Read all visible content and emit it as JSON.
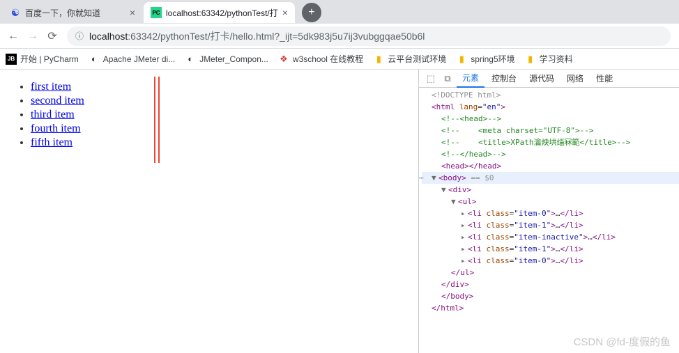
{
  "tabs": [
    {
      "title": "百度一下，你就知道",
      "favicon": "🐾",
      "active": false
    },
    {
      "title": "localhost:63342/pythonTest/打",
      "favicon": "PC",
      "active": true
    }
  ],
  "newtab": "+",
  "nav": {
    "back": "←",
    "fwd": "→",
    "reload": "⟳",
    "lock": "ⓘ"
  },
  "url": {
    "host": "localhost",
    "path": ":63342/pythonTest/打卡/hello.html?_ijt=5dk983j5u7ij3vubggqae50b6l"
  },
  "bookmarks": [
    {
      "icon": "JB",
      "label": "开始 | PyCharm",
      "type": "jb"
    },
    {
      "icon": "◐",
      "label": "Apache JMeter di...",
      "type": "apache"
    },
    {
      "icon": "◐",
      "label": "JMeter_Compon...",
      "type": "apache"
    },
    {
      "icon": "❖",
      "label": "w3school 在线教程",
      "type": "w3"
    },
    {
      "icon": "▮",
      "label": "云平台测试环境",
      "type": "folder"
    },
    {
      "icon": "▮",
      "label": "spring5环境",
      "type": "folder"
    },
    {
      "icon": "▮",
      "label": "学习资料",
      "type": "folder"
    }
  ],
  "page_items": [
    "first item",
    "second item",
    "third item",
    "fourth item",
    "fifth item"
  ],
  "devtools": {
    "tabs": [
      "元素",
      "控制台",
      "源代码",
      "网络",
      "性能"
    ],
    "active_tab": 0,
    "doctype": "<!DOCTYPE html>",
    "html_open": "<html lang=\"en\">",
    "head_c1": "<!--<head>-->",
    "head_c2": "<!--    <meta charset=\"UTF-8\">-->",
    "head_c3": "<!--    <title>XPath瀹炴垬缁冧範</title>-->",
    "head_c4": "<!--</head>-->",
    "head": "<head></head>",
    "body_open": "<body>",
    "body_eq": " == $0",
    "div_open": "<div>",
    "ul_open": "<ul>",
    "li_rows": [
      {
        "cls": "item-0"
      },
      {
        "cls": "item-1"
      },
      {
        "cls": "item-inactive"
      },
      {
        "cls": "item-1"
      },
      {
        "cls": "item-0"
      }
    ],
    "ul_close": "</ul>",
    "div_close": "</div>",
    "body_close": "</body>",
    "html_close": "</html>"
  },
  "watermark": "CSDN @fd-度假的鱼"
}
